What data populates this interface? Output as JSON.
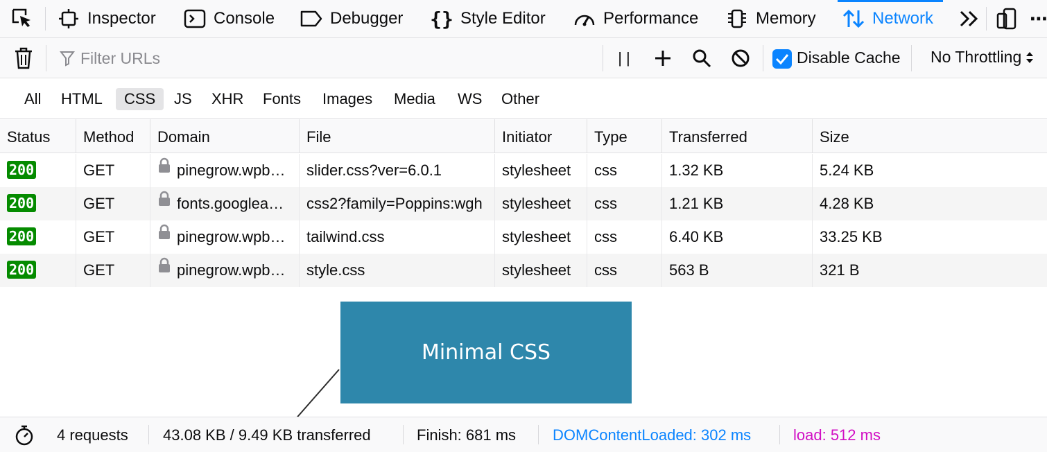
{
  "tabs": [
    {
      "label": "Inspector",
      "icon": "inspector-icon"
    },
    {
      "label": "Console",
      "icon": "console-icon"
    },
    {
      "label": "Debugger",
      "icon": "debugger-icon"
    },
    {
      "label": "Style Editor",
      "icon": "style-editor-icon"
    },
    {
      "label": "Performance",
      "icon": "performance-icon"
    },
    {
      "label": "Memory",
      "icon": "memory-icon"
    },
    {
      "label": "Network",
      "icon": "network-icon",
      "active": true
    }
  ],
  "toolbar": {
    "filter_placeholder": "Filter URLs",
    "disable_cache_label": "Disable Cache",
    "disable_cache_checked": true,
    "throttling_value": "No Throttling",
    "pause_glyph": "| |"
  },
  "type_filters": [
    "All",
    "HTML",
    "CSS",
    "JS",
    "XHR",
    "Fonts",
    "Images",
    "Media",
    "WS",
    "Other"
  ],
  "selected_type_filter": "CSS",
  "table": {
    "columns": [
      "Status",
      "Method",
      "Domain",
      "File",
      "Initiator",
      "Type",
      "Transferred",
      "Size"
    ],
    "rows": [
      {
        "status": "200",
        "method": "GET",
        "domain": "pinegrow.wpb…",
        "file": "slider.css?ver=6.0.1",
        "initiator": "stylesheet",
        "type": "css",
        "transferred": "1.32 KB",
        "size": "5.24 KB"
      },
      {
        "status": "200",
        "method": "GET",
        "domain": "fonts.googlea…",
        "file": "css2?family=Poppins:wgh",
        "initiator": "stylesheet",
        "type": "css",
        "transferred": "1.21 KB",
        "size": "4.28 KB"
      },
      {
        "status": "200",
        "method": "GET",
        "domain": "pinegrow.wpb…",
        "file": "tailwind.css",
        "initiator": "stylesheet",
        "type": "css",
        "transferred": "6.40 KB",
        "size": "33.25 KB"
      },
      {
        "status": "200",
        "method": "GET",
        "domain": "pinegrow.wpb…",
        "file": "style.css",
        "initiator": "stylesheet",
        "type": "css",
        "transferred": "563 B",
        "size": "321 B"
      }
    ]
  },
  "callout": {
    "text": "Minimal CSS",
    "color": "#2e87ab"
  },
  "status_bar": {
    "requests": "4 requests",
    "transferred": "43.08 KB / 9.49 KB transferred",
    "finish": "Finish: 681 ms",
    "dom_content_loaded": "DOMContentLoaded: 302 ms",
    "load": "load: 512 ms"
  },
  "colors": {
    "accent": "#0a84ff",
    "status_ok": "#058b00",
    "load": "#d10ec4"
  }
}
